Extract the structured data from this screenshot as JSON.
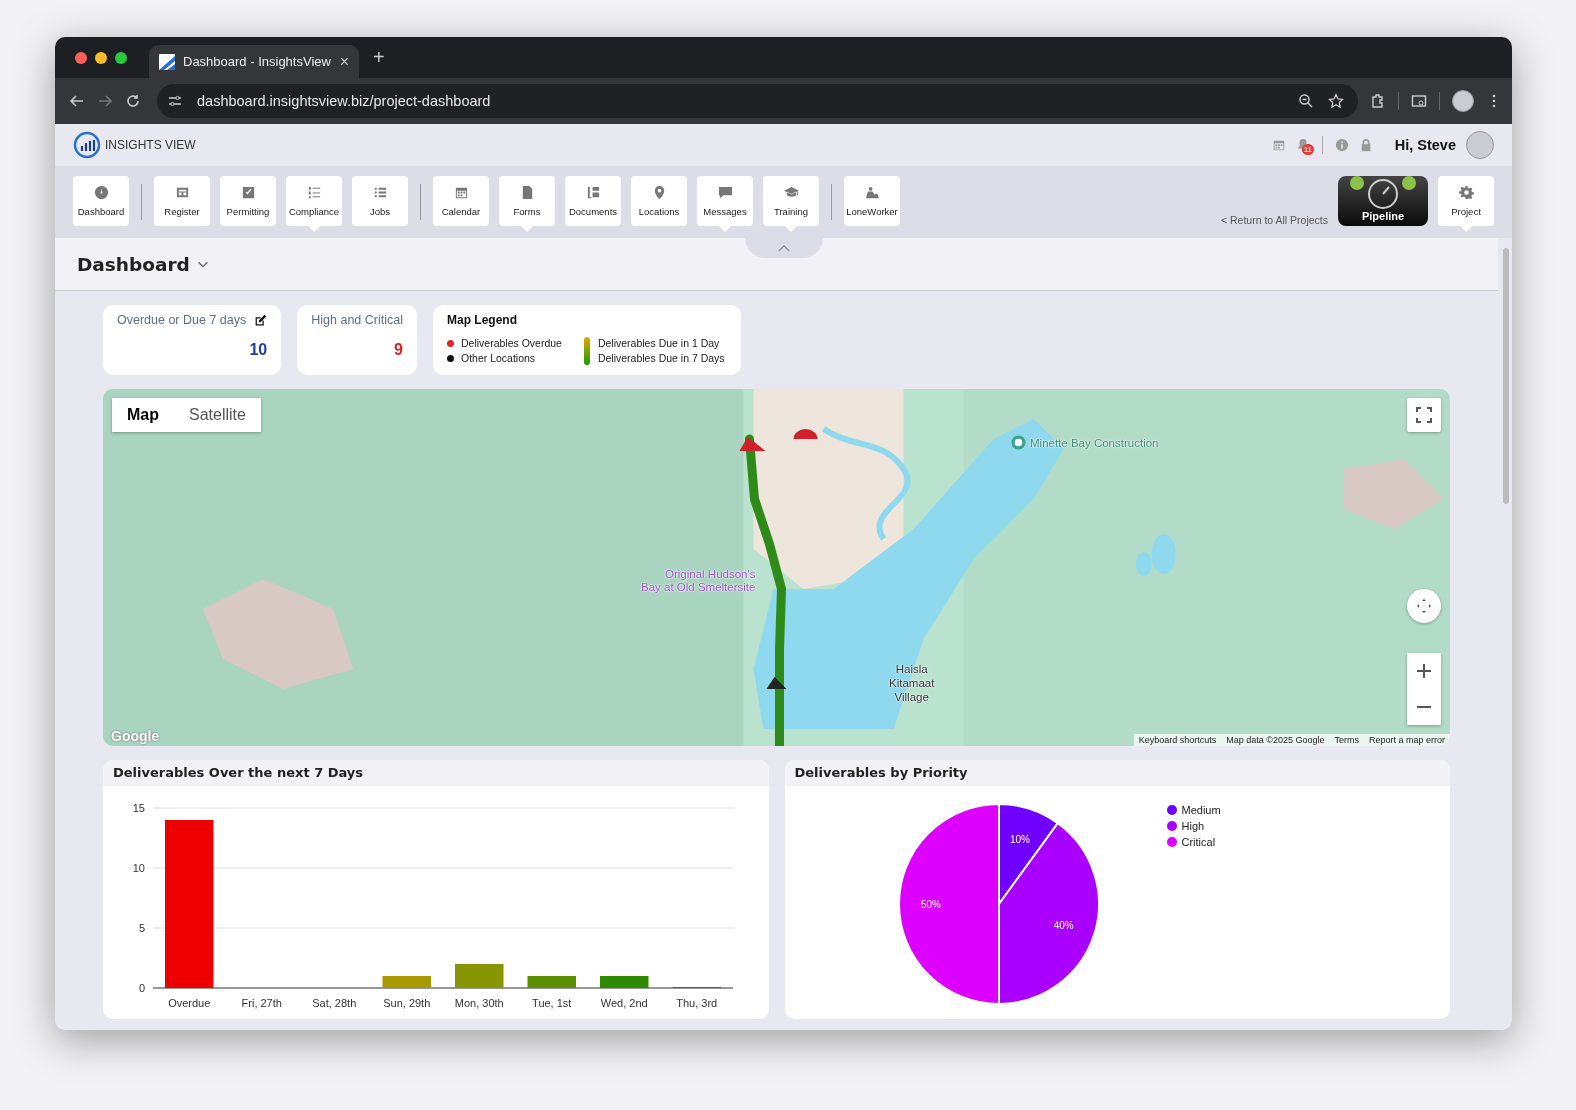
{
  "browser": {
    "tab_title": "Dashboard - InsightsView",
    "new_tab": "+",
    "tab_close": "×",
    "url": "dashboard.insightsview.biz/project-dashboard"
  },
  "header": {
    "logo_text": "INSIGHTS VIEW",
    "notification_count": "11",
    "greeting": "Hi, Steve"
  },
  "toolbar": [
    [
      {
        "label": "Dashboard",
        "has_menu": false
      }
    ],
    [
      {
        "label": "Register",
        "has_menu": false
      },
      {
        "label": "Permitting",
        "has_menu": false
      },
      {
        "label": "Compliance",
        "has_menu": true
      },
      {
        "label": "Jobs",
        "has_menu": false
      }
    ],
    [
      {
        "label": "Calendar",
        "has_menu": false
      },
      {
        "label": "Forms",
        "has_menu": true
      },
      {
        "label": "Documents",
        "has_menu": false
      },
      {
        "label": "Locations",
        "has_menu": false
      },
      {
        "label": "Messages",
        "has_menu": true
      },
      {
        "label": "Training",
        "has_menu": true
      }
    ],
    [
      {
        "label": "LoneWorker",
        "has_menu": false
      }
    ]
  ],
  "return_link": "< Return to All Projects",
  "project_badge": "Pipeline",
  "project_button": {
    "label": "Project",
    "has_menu": true
  },
  "page_title": "Dashboard",
  "cards": [
    {
      "title": "Overdue or Due 7 days",
      "value": "10",
      "color": "#1f3fa8",
      "editable": true
    },
    {
      "title": "High and Critical",
      "value": "9",
      "color": "#e02020",
      "editable": false
    }
  ],
  "legend": {
    "title": "Map Legend",
    "dots": [
      {
        "label": "Deliverables Overdue",
        "color": "#e02828"
      },
      {
        "label": "Other Locations",
        "color": "#111111"
      }
    ],
    "gradient": [
      "Deliverables Due in 1 Day",
      "Deliverables Due in 7 Days"
    ]
  },
  "map": {
    "tabs": [
      {
        "label": "Map",
        "selected": true
      },
      {
        "label": "Satellite",
        "selected": false
      }
    ],
    "places": [
      {
        "label": "Minette Bay Construction",
        "kind": "poi"
      },
      {
        "label": "Original Hudson's\nBay at Old Smeltersite",
        "kind": "landmark"
      },
      {
        "label": "Haisla\nKitamaat\nVillage",
        "kind": "town"
      }
    ],
    "logo": "Google",
    "attribution": [
      "Keyboard shortcuts",
      "Map data ©2025 Google",
      "Terms",
      "Report a map error"
    ]
  },
  "bar_chart": {
    "title": "Deliverables Over the next 7 Days",
    "chart_data": {
      "type": "bar",
      "categories": [
        "Overdue",
        "Fri, 27th",
        "Sat, 28th",
        "Sun, 29th",
        "Mon, 30th",
        "Tue, 1st",
        "Wed, 2nd",
        "Thu, 3rd"
      ],
      "values": [
        14,
        0,
        0,
        1,
        2,
        1,
        1,
        0
      ],
      "colors": [
        "#ee0000",
        "#c8a000",
        "#c0a000",
        "#a89a00",
        "#869600",
        "#5a9000",
        "#2e8a00",
        "#1a8a00"
      ],
      "ylim": [
        0,
        15
      ],
      "yticks": [
        0,
        5,
        10,
        15
      ]
    }
  },
  "pie_chart": {
    "title": "Deliverables by Priority",
    "chart_data": {
      "type": "pie",
      "categories": [
        "Medium",
        "High",
        "Critical"
      ],
      "values": [
        10,
        40,
        50
      ],
      "colors": [
        "#7000ff",
        "#aa00ff",
        "#dd00ff"
      ],
      "value_labels": [
        "10%",
        "40%",
        "50%"
      ]
    }
  }
}
